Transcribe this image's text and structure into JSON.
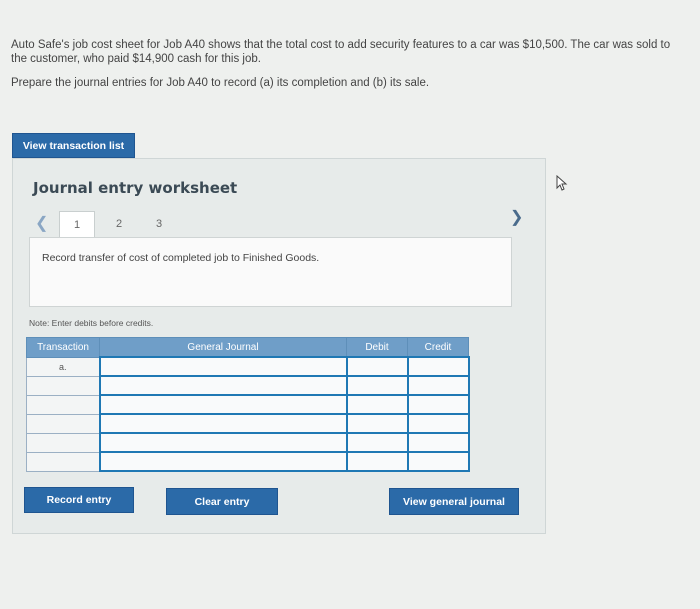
{
  "problem": {
    "line1": "Auto Safe's job cost sheet for Job A40 shows that the total cost to add security features to a car was $10,500. The car was sold to",
    "line2": "the customer, who paid $14,900 cash for this job.",
    "prompt": "Prepare the journal entries for Job A40 to record (a) its completion and (b) its sale."
  },
  "buttons": {
    "view_transaction_list": "View transaction list",
    "record_entry": "Record entry",
    "clear_entry": "Clear entry",
    "view_general_journal": "View general journal"
  },
  "worksheet": {
    "title": "Journal entry worksheet",
    "prev_icon": "chevron-left-icon",
    "next_icon": "chevron-right-icon",
    "tabs": [
      "1",
      "2",
      "3"
    ],
    "active_tab": "1",
    "instruction": "Record transfer of cost of completed job to Finished Goods.",
    "note": "Note: Enter debits before credits."
  },
  "table": {
    "headers": {
      "transaction": "Transaction",
      "general_journal": "General Journal",
      "debit": "Debit",
      "credit": "Credit"
    },
    "rows": [
      {
        "transaction": "a.",
        "general_journal": "",
        "debit": "",
        "credit": ""
      },
      {
        "transaction": "",
        "general_journal": "",
        "debit": "",
        "credit": ""
      },
      {
        "transaction": "",
        "general_journal": "",
        "debit": "",
        "credit": ""
      },
      {
        "transaction": "",
        "general_journal": "",
        "debit": "",
        "credit": ""
      },
      {
        "transaction": "",
        "general_journal": "",
        "debit": "",
        "credit": ""
      },
      {
        "transaction": "",
        "general_journal": "",
        "debit": "",
        "credit": ""
      }
    ]
  },
  "colors": {
    "button_blue": "#2b6aa8",
    "table_header": "#6f9ec8",
    "input_border": "#1f78b4"
  },
  "cursor_icon": "mouse-pointer-icon"
}
